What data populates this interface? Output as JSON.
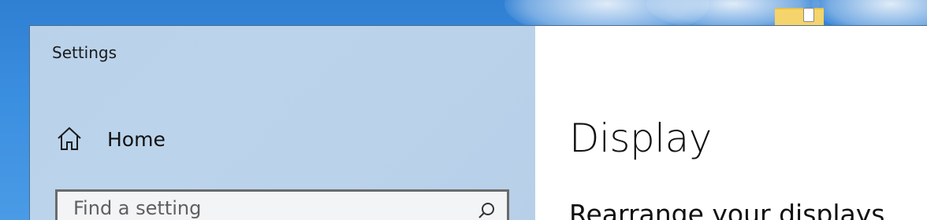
{
  "window": {
    "title": "Settings"
  },
  "sidebar": {
    "home": {
      "label": "Home",
      "icon": "home-icon"
    },
    "search": {
      "placeholder": "Find a setting",
      "icon": "search-icon"
    }
  },
  "main": {
    "title": "Display",
    "section_title": "Rearrange your displays"
  },
  "colors": {
    "sidebar_bg": "#bcd4eb",
    "content_bg": "#ffffff",
    "desktop_bg": "#3b8fe0"
  }
}
